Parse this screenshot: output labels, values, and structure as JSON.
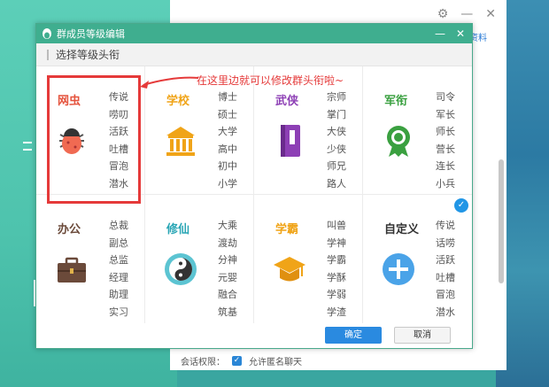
{
  "background": {
    "link_text": "资料",
    "min_icon": "gear-icon",
    "footer": {
      "label": "会话权限：",
      "checkbox_label": "允许匿名聊天"
    }
  },
  "dialog": {
    "title": "群成员等级编辑",
    "sub_header": "选择等级头衔",
    "annotation": "在这里边就可以修改群头衔啦~",
    "categories": [
      {
        "name": "网虫",
        "color": "#e5533d",
        "icon": "bug-icon",
        "levels": [
          "传说",
          "唠叨",
          "活跃",
          "吐槽",
          "冒泡",
          "潜水"
        ]
      },
      {
        "name": "学校",
        "color": "#f0a418",
        "icon": "school-building-icon",
        "levels": [
          "博士",
          "硕士",
          "大学",
          "高中",
          "初中",
          "小学"
        ]
      },
      {
        "name": "武侠",
        "color": "#8d3fb5",
        "icon": "book-icon",
        "levels": [
          "宗师",
          "掌门",
          "大侠",
          "少侠",
          "师兄",
          "路人"
        ]
      },
      {
        "name": "军衔",
        "color": "#3aa040",
        "icon": "medal-icon",
        "levels": [
          "司令",
          "军长",
          "师长",
          "营长",
          "连长",
          "小兵"
        ]
      },
      {
        "name": "办公",
        "color": "#6b4a3a",
        "icon": "briefcase-icon",
        "levels": [
          "总裁",
          "副总",
          "总监",
          "经理",
          "助理",
          "实习"
        ]
      },
      {
        "name": "修仙",
        "color": "#2aa6b5",
        "icon": "yin-yang-icon",
        "levels": [
          "大乘",
          "渡劫",
          "分神",
          "元婴",
          "融合",
          "筑基"
        ]
      },
      {
        "name": "学霸",
        "color": "#f0a418",
        "icon": "graduation-cap-icon",
        "levels": [
          "叫兽",
          "学神",
          "学霸",
          "学酥",
          "学弱",
          "学渣"
        ]
      },
      {
        "name": "自定义",
        "color": "#333333",
        "icon": "plus-icon",
        "levels": [
          "传说",
          "话唠",
          "活跃",
          "吐槽",
          "冒泡",
          "潜水"
        ]
      }
    ],
    "ok_label": "确定",
    "cancel_label": "取消"
  },
  "colors": {
    "accent": "#3fae8f",
    "primary_button": "#2a8ae0",
    "highlight": "#e53a3a"
  }
}
